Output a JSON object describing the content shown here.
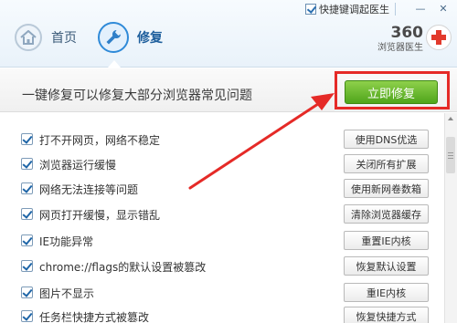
{
  "titlebar": {
    "shortcut_checked": true,
    "shortcut_label": "快捷键调起医生",
    "minimize_symbol": "—",
    "close_symbol": "✕"
  },
  "nav": {
    "home_label": "首页",
    "home_icon": "home-icon",
    "repair_label": "修复",
    "repair_icon": "wrench-icon",
    "active": "repair"
  },
  "brand": {
    "number": "360",
    "subtitle": "浏览器医生",
    "icon": "red-cross-icon"
  },
  "banner": {
    "text": "一键修复可以修复大部分浏览器常见问题",
    "repair_now_label": "立即修复"
  },
  "issues": [
    {
      "label": "打不开网页，网络不稳定",
      "action": "使用DNS优选",
      "checked": true
    },
    {
      "label": "浏览器运行缓慢",
      "action": "关闭所有扩展",
      "checked": true
    },
    {
      "label": "网络无法连接等问题",
      "action": "使用新网卷数箱",
      "checked": true
    },
    {
      "label": "网页打开缓慢，显示错乱",
      "action": "清除浏览器缓存",
      "checked": true
    },
    {
      "label": "IE功能异常",
      "action": "重置IE内核",
      "checked": true
    },
    {
      "label": "chrome://flags的默认设置被篡改",
      "action": "恢复默认设置",
      "checked": true
    },
    {
      "label": "图片不显示",
      "action": "重IE内核",
      "checked": true
    },
    {
      "label": "任务栏快捷方式被篡改",
      "action": "恢复快捷方式",
      "checked": true
    }
  ],
  "colors": {
    "accent_blue": "#2f8ad8",
    "repair_green": "#4fa51b",
    "annotation_red": "#e52a27"
  }
}
